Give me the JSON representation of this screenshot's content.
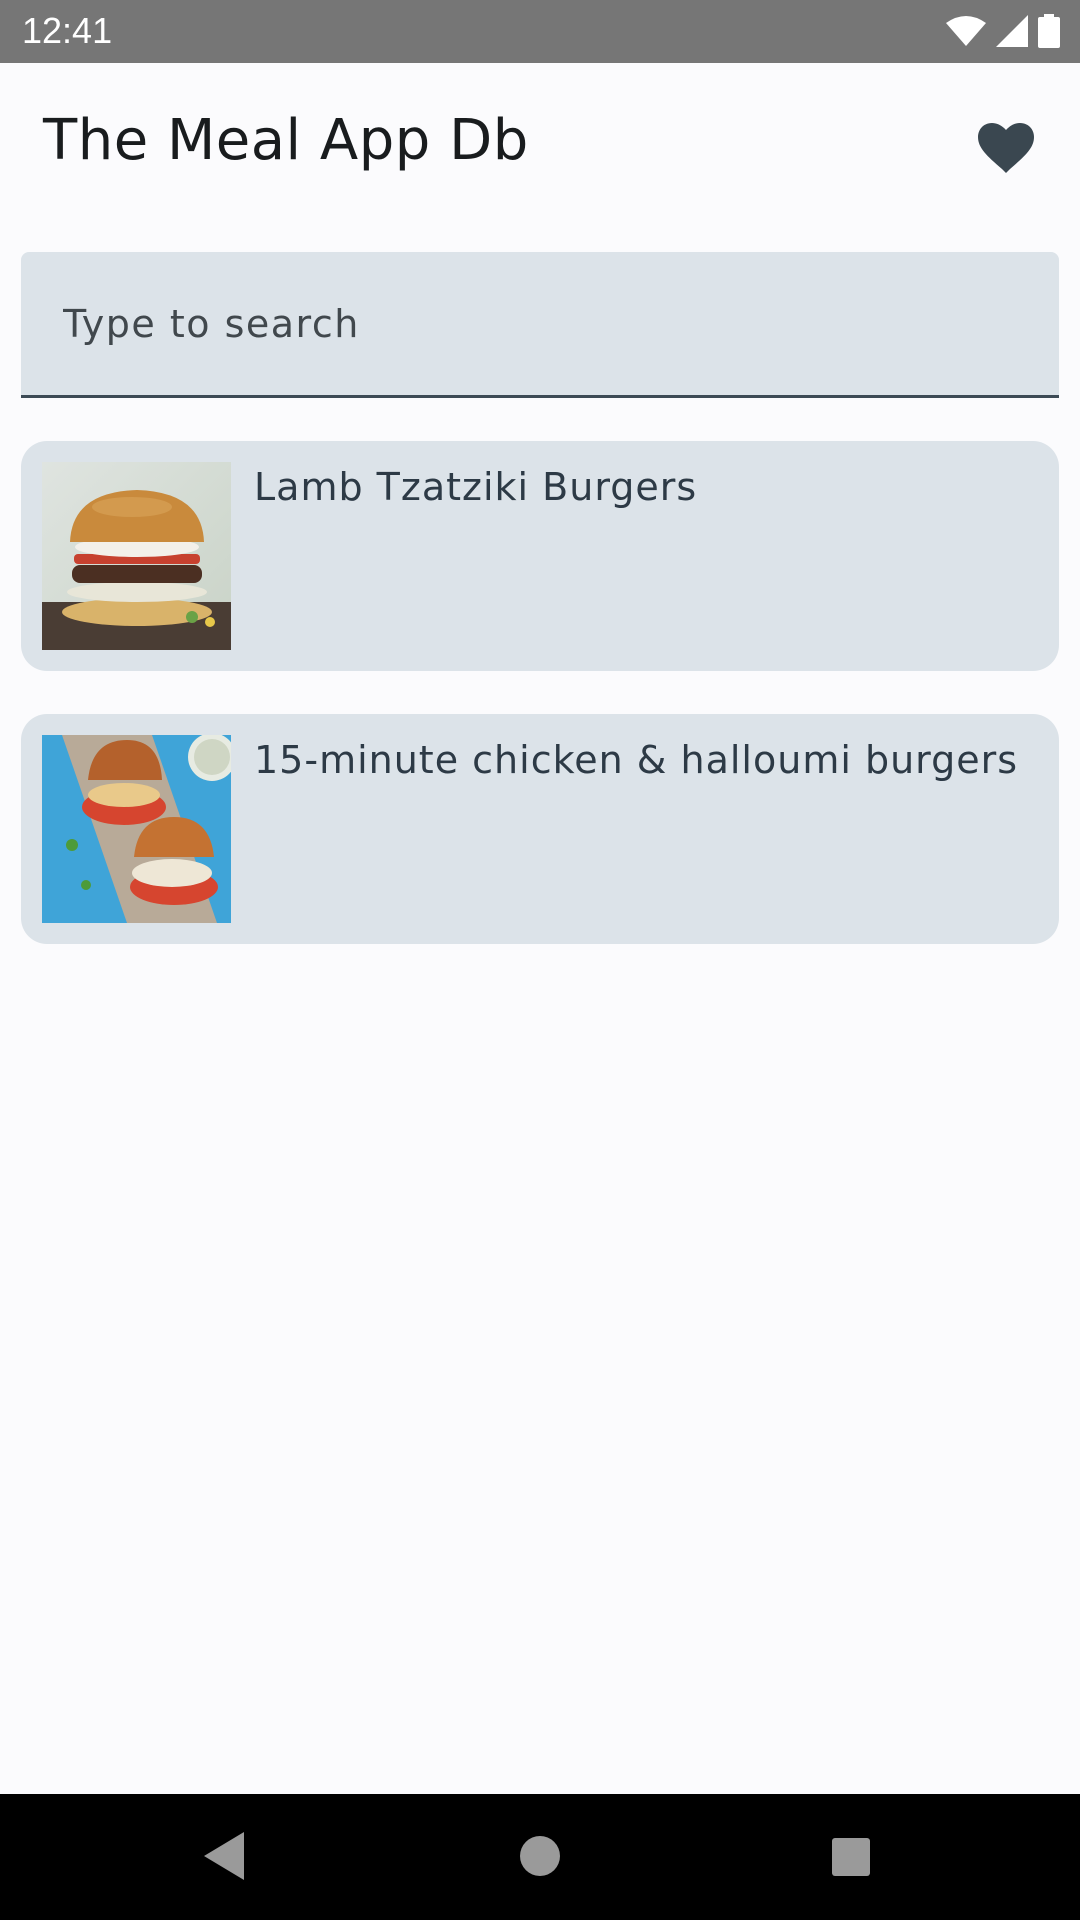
{
  "status_bar": {
    "time": "12:41",
    "icons": [
      "wifi-icon",
      "cell-signal-icon",
      "battery-icon"
    ]
  },
  "app_bar": {
    "title": "The Meal App Db",
    "action_icon": "heart-icon"
  },
  "search": {
    "placeholder": "Type to search",
    "value": ""
  },
  "meals": [
    {
      "name": "Lamb Tzatziki Burgers",
      "image": "lamb-tzatziki-burger-photo"
    },
    {
      "name": "15-minute chicken & halloumi burgers",
      "image": "chicken-halloumi-burgers-photo"
    }
  ],
  "nav_bar": {
    "buttons": [
      "back-icon",
      "home-icon",
      "recents-icon"
    ]
  },
  "colors": {
    "background": "#fbfbfd",
    "surface": "#dce3e9",
    "text": "#2d3a46",
    "status_bar": "#767676",
    "nav_bar": "#000000"
  }
}
